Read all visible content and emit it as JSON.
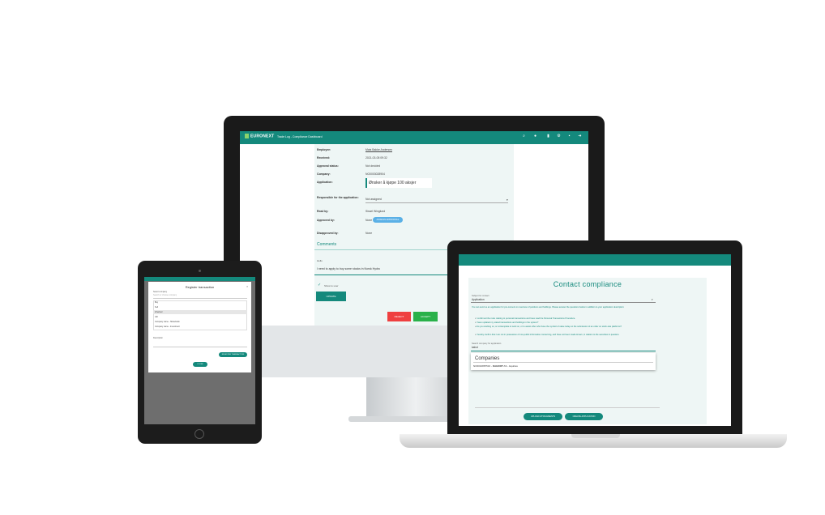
{
  "desktop": {
    "logo": "EURONEXT",
    "app_title": "Trade Log - Compliance Dashboard",
    "rows": [
      {
        "label": "Employee:",
        "value": "Mats Bakke Andersen"
      },
      {
        "label": "Received:",
        "value": "2021-03-05 09:32"
      },
      {
        "label": "Approval status:",
        "value": "Not decided"
      },
      {
        "label": "Company:",
        "value": "NO0003028904"
      },
      {
        "label": "Application:",
        "value": ""
      }
    ],
    "application_text": "Ønsker å kjøpe 100 aksjer",
    "responsible_label": "Responsible for the application:",
    "responsible_value": "Not assigned",
    "read_by_label": "Read by:",
    "read_by_value": "Sissel Winglund",
    "approved_by_label": "Approved by:",
    "approved_by_value": "None",
    "approve_pill": "ASSIGN APPROVAL",
    "disapproved_label": "Disapproved by:",
    "disapproved_value": "None",
    "comments_heading": "Comments",
    "comment_user": "Hello",
    "comment_text": "I need to apply to buy some stocks in Norsk Hydro",
    "checkbox_label": "Show to user",
    "update_button": "UPDATE",
    "reject_button": "REJECT",
    "accept_button": "ACCEPT"
  },
  "tablet": {
    "modal_title": "Register transaction",
    "close_glyph": "×",
    "field_label": "Select company",
    "field_placeholder": "Search or choose company",
    "options": [
      "Buy",
      "Sell",
      "Inherited",
      "Gift",
      "Company name - Sharebank",
      "Company name - Investment"
    ],
    "selected_index": 2,
    "second_field_label": "Description",
    "register_button": "REGISTER TRANSACTION",
    "close_button": "CLOSE"
  },
  "laptop": {
    "title": "Contact compliance",
    "subject_label": "Subject for contact",
    "subject_value": "Application",
    "intro_text": "You can send us an application for pre-consent on overview of positions and holdings. Please answer the questions below in addition to your application description:",
    "bullets": [
      "I confirmed the rules relating to personal transactions and have read the Personal Transactions Procedure.",
      "I have updated my stated transactions and holdings in the system?",
      "Are you working on, or contemplate to work on, or to assist other who have the symbol of value today on the submission of an order on stock-rate platforms?",
      "I hereby confirm that I am not in possession of non-public information concerning, and have not been made known, in relation to the securities in question."
    ],
    "search_label": "Search company for application",
    "search_value": "kahot",
    "dropdown_heading": "Companies",
    "dropdown_item_code": "NO0010887516 - ",
    "dropdown_item_bold": "KAHOOT",
    "dropdown_item_rest": " AS - Equities",
    "attachments_button": "UPLOAD ATTACHMENTS",
    "send_button": "CREATE APPLICATION"
  },
  "colors": {
    "teal": "#14897c",
    "red": "#ef4040",
    "green": "#29b14a",
    "blue": "#5ab0e6"
  }
}
